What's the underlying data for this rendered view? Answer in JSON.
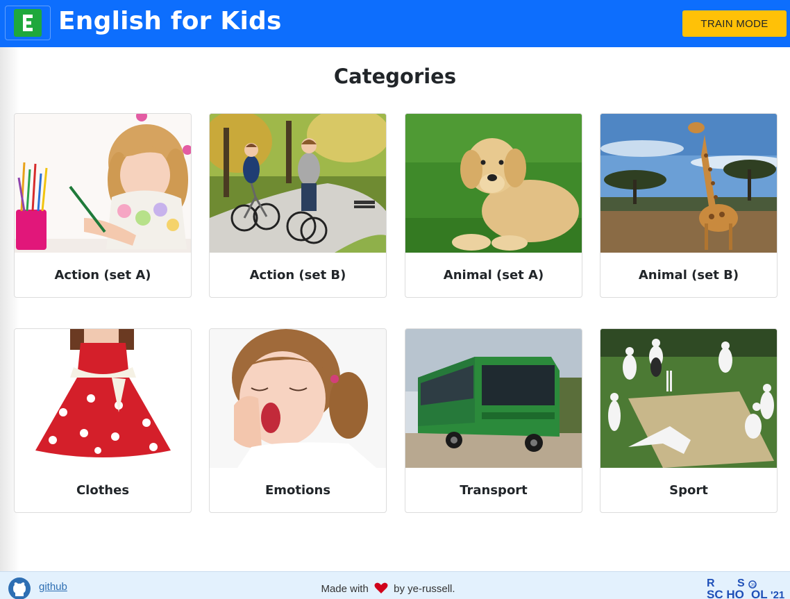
{
  "header": {
    "logo_letter": "E",
    "app_title": "English for Kids",
    "train_mode_label": "TRAIN MODE"
  },
  "main": {
    "page_title": "Categories",
    "categories": [
      {
        "label": "Action (set A)",
        "image_icon": "girl-drawing-image"
      },
      {
        "label": "Action (set B)",
        "image_icon": "kids-cycling-image"
      },
      {
        "label": "Animal (set A)",
        "image_icon": "puppy-image"
      },
      {
        "label": "Animal (set B)",
        "image_icon": "giraffe-image"
      },
      {
        "label": "Clothes",
        "image_icon": "red-dress-image"
      },
      {
        "label": "Emotions",
        "image_icon": "yawning-girl-image"
      },
      {
        "label": "Transport",
        "image_icon": "green-bus-image"
      },
      {
        "label": "Sport",
        "image_icon": "cricket-image"
      }
    ]
  },
  "footer": {
    "github_label": "github",
    "made_with_prefix": "Made with",
    "made_with_suffix": "by ye-russell.",
    "rs_logo_text": "RS SCHOOL '21"
  },
  "colors": {
    "header_bg": "#0d6efd",
    "train_button": "#ffc107",
    "logo_green": "#1fa83c",
    "footer_bg": "#e3f1fd",
    "heart": "#d0021b"
  }
}
